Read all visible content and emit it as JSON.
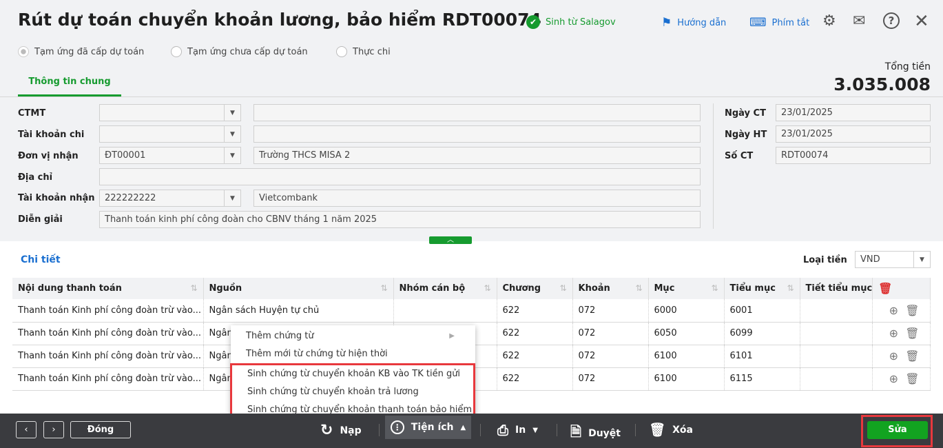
{
  "header": {
    "title": "Rút dự toán chuyển khoản lương, bảo hiểm RDT00074",
    "badge": "Sinh từ Salagov",
    "guide": "Hướng dẫn",
    "shortcuts": "Phím tắt"
  },
  "radios": [
    {
      "label": "Tạm ứng đã cấp dự toán",
      "checked": true
    },
    {
      "label": "Tạm ứng chưa cấp dự toán",
      "checked": false
    },
    {
      "label": "Thực chi",
      "checked": false
    }
  ],
  "tab": "Thông tin chung",
  "total": {
    "label": "Tổng tiền",
    "value": "3.035.008"
  },
  "form": {
    "ctmt": {
      "label": "CTMT",
      "code": "",
      "name": ""
    },
    "tk_chi": {
      "label": "Tài khoản chi",
      "code": "",
      "name": ""
    },
    "don_vi": {
      "label": "Đơn vị nhận",
      "code": "ĐT00001",
      "name": "Trường THCS MISA 2"
    },
    "dia_chi": {
      "label": "Địa chỉ",
      "value": ""
    },
    "tk_nhan": {
      "label": "Tài khoản nhận",
      "code": "222222222",
      "name": "Vietcombank"
    },
    "dien_giai": {
      "label": "Diễn giải",
      "value": "Thanh toán kinh phí công đoàn cho CBNV tháng 1 năm 2025"
    },
    "ngay_ct": {
      "label": "Ngày CT",
      "value": "23/01/2025"
    },
    "ngay_ht": {
      "label": "Ngày HT",
      "value": "23/01/2025"
    },
    "so_ct": {
      "label": "Số CT",
      "value": "RDT00074"
    }
  },
  "detail": {
    "title": "Chi tiết",
    "currency_label": "Loại tiền",
    "currency": "VND",
    "columns": [
      "Nội dung thanh toán",
      "Nguồn",
      "Nhóm cán bộ",
      "Chương",
      "Khoản",
      "Mục",
      "Tiểu mục",
      "Tiết tiểu mục"
    ],
    "rows": [
      [
        "Thanh toán Kinh phí công đoàn trừ vào...",
        "Ngân sách Huyện tự chủ",
        "",
        "622",
        "072",
        "6000",
        "6001",
        ""
      ],
      [
        "Thanh toán Kinh phí công đoàn trừ vào...",
        "Ngân",
        "",
        "622",
        "072",
        "6050",
        "6099",
        ""
      ],
      [
        "Thanh toán Kinh phí công đoàn trừ vào...",
        "Ngân",
        "",
        "622",
        "072",
        "6100",
        "6101",
        ""
      ],
      [
        "Thanh toán Kinh phí công đoàn trừ vào...",
        "Ngân",
        "",
        "622",
        "072",
        "6100",
        "6115",
        ""
      ]
    ]
  },
  "menu": [
    "Thêm chứng từ",
    "Thêm mới từ chứng từ hiện thời",
    "Sinh chứng từ chuyển khoản KB vào TK tiền gửi",
    "Sinh chứng từ chuyển khoản trả lương",
    "Sinh chứng từ chuyển khoản thanh toán bảo hiểm"
  ],
  "footer": {
    "close": "Đóng",
    "reload": "Nạp",
    "utilities": "Tiện ích",
    "print": "In",
    "approve": "Duyệt",
    "delete": "Xóa",
    "edit": "Sửa"
  },
  "colors": {
    "accent": "#169b2f",
    "link": "#1a6fd0",
    "highlight": "#e8383d"
  }
}
